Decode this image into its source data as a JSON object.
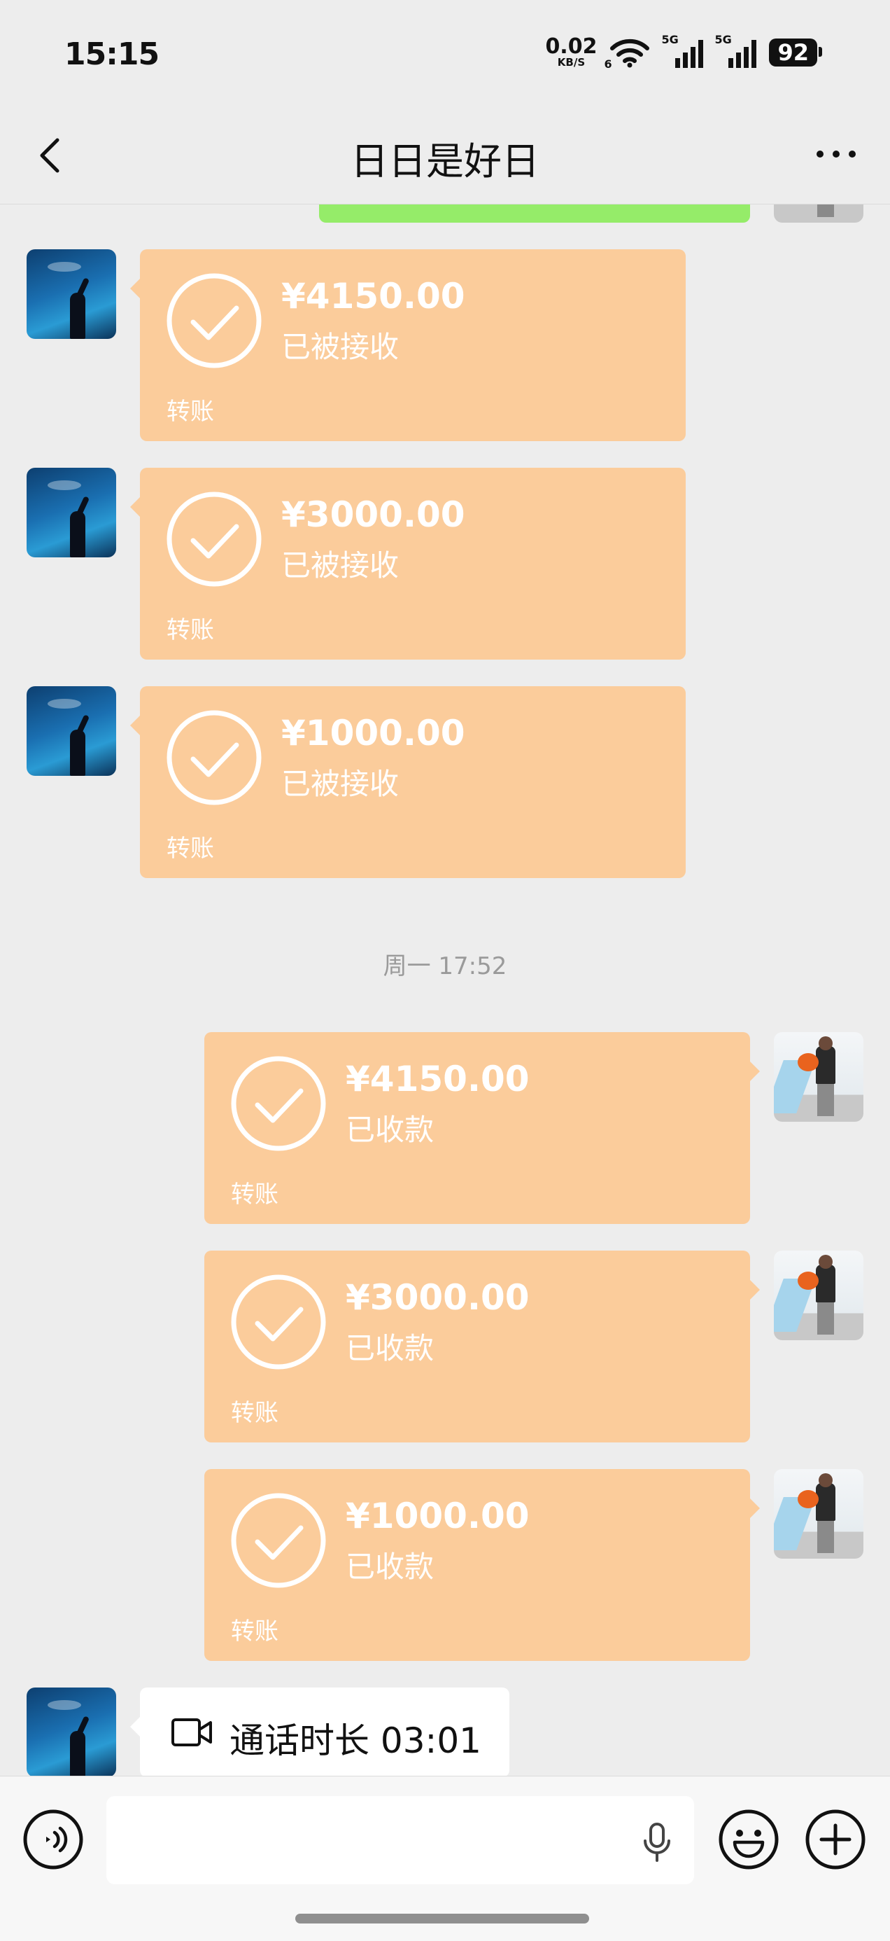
{
  "status_bar": {
    "time": "15:15",
    "net_speed_value": "0.02",
    "net_speed_unit": "KB/S",
    "wifi_tag": "6",
    "signal1_tag": "5G",
    "signal2_tag": "5G",
    "battery": "92"
  },
  "header": {
    "title": "日日是好日"
  },
  "messages": {
    "received": [
      {
        "amount": "¥4150.00",
        "status": "已被接收",
        "label": "转账"
      },
      {
        "amount": "¥3000.00",
        "status": "已被接收",
        "label": "转账"
      },
      {
        "amount": "¥1000.00",
        "status": "已被接收",
        "label": "转账"
      }
    ],
    "timestamp": "周一 17:52",
    "sent": [
      {
        "amount": "¥4150.00",
        "status": "已收款",
        "label": "转账"
      },
      {
        "amount": "¥3000.00",
        "status": "已收款",
        "label": "转账"
      },
      {
        "amount": "¥1000.00",
        "status": "已收款",
        "label": "转账"
      }
    ],
    "call": {
      "text": "通话时长 03:01"
    }
  },
  "colors": {
    "transfer_bubble": "#fbcc9b",
    "sent_text_bubble": "#95ec69",
    "background": "#ededed"
  },
  "icons": {
    "back": "chevron-left-icon",
    "more": "more-dots-icon",
    "check": "check-circle-icon",
    "video": "video-camera-icon",
    "voice": "voice-icon",
    "mic": "microphone-icon",
    "emoji": "emoji-icon",
    "plus": "plus-circle-icon"
  }
}
